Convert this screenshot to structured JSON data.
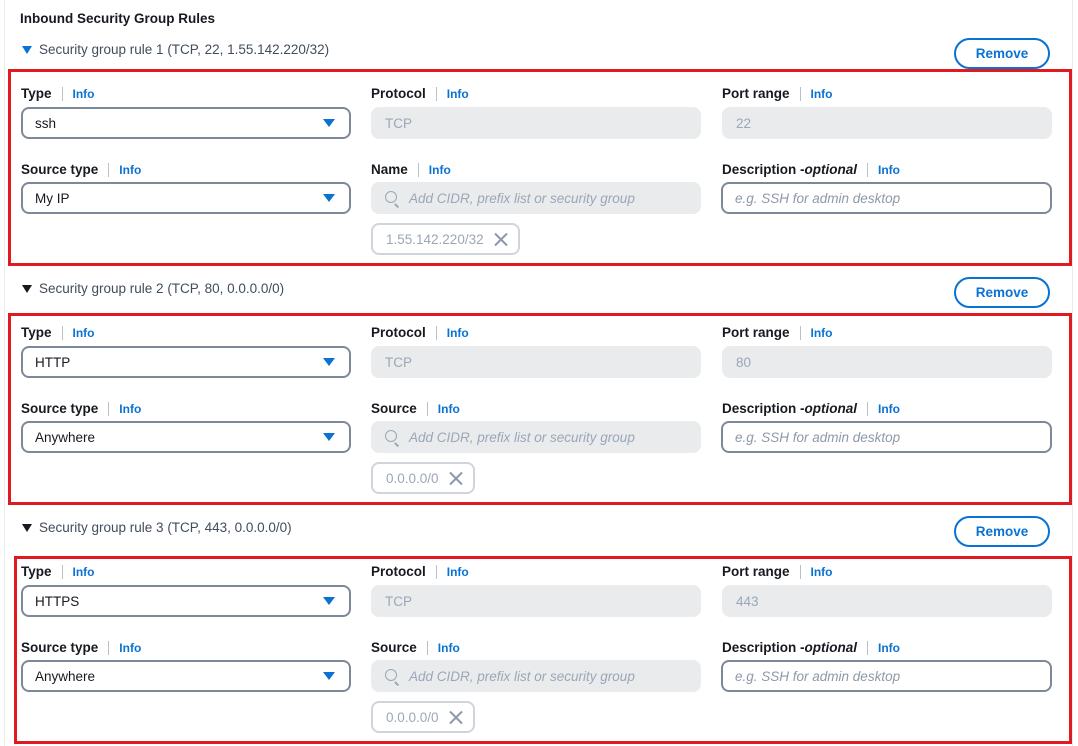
{
  "heading": "Inbound Security Group Rules",
  "labels": {
    "type": "Type",
    "protocol": "Protocol",
    "port_range": "Port range",
    "source_type": "Source type",
    "description": "Description - ",
    "optional": "optional",
    "info": "Info",
    "remove": "Remove",
    "cidr_placeholder": "Add CIDR, prefix list or security group",
    "description_placeholder": "e.g. SSH for admin desktop"
  },
  "rules": [
    {
      "header": "Security group rule 1 (TCP, 22, 1.55.142.220/32)",
      "type": "ssh",
      "protocol": "TCP",
      "port_range": "22",
      "source_type": "My IP",
      "source_label": "Name",
      "source_token": "1.55.142.220/32"
    },
    {
      "header": "Security group rule 2 (TCP, 80, 0.0.0.0/0)",
      "type": "HTTP",
      "protocol": "TCP",
      "port_range": "80",
      "source_type": "Anywhere",
      "source_label": "Source",
      "source_token": "0.0.0.0/0"
    },
    {
      "header": "Security group rule 3 (TCP, 443, 0.0.0.0/0)",
      "type": "HTTPS",
      "protocol": "TCP",
      "port_range": "443",
      "source_type": "Anywhere",
      "source_label": "Source",
      "source_token": "0.0.0.0/0"
    }
  ],
  "colors": {
    "highlight": "#e11a22",
    "link": "#0972d3",
    "disabled_bg": "#e9ebed"
  }
}
